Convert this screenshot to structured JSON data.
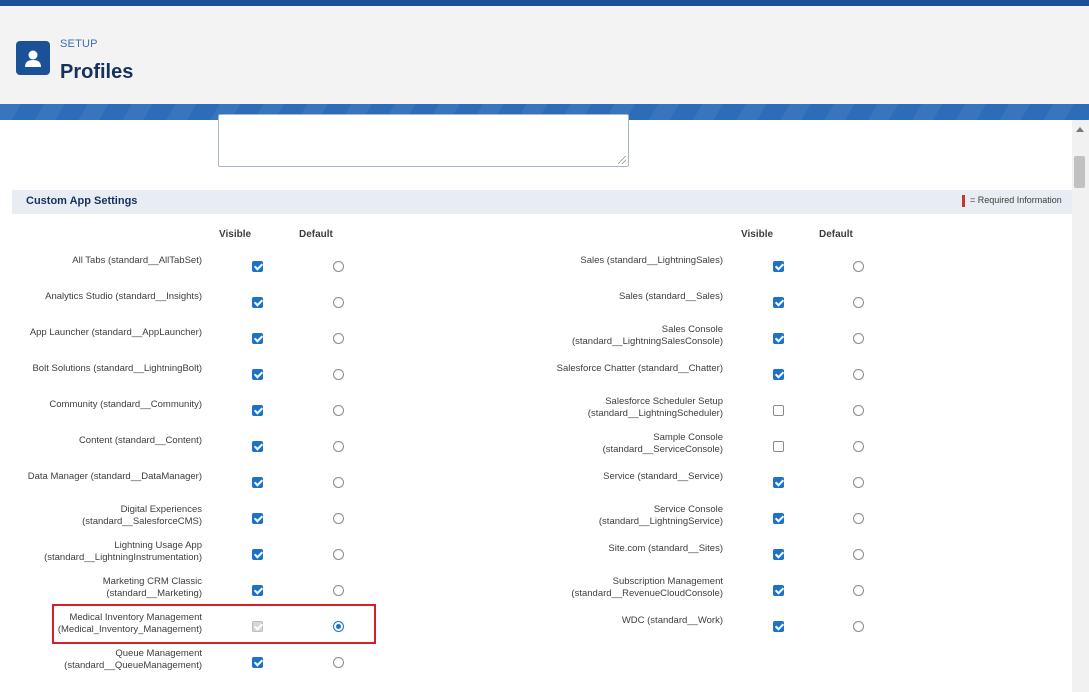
{
  "header": {
    "eyebrow": "SETUP",
    "title": "Profiles",
    "icon": "user-icon"
  },
  "section": {
    "title": "Custom App Settings",
    "required_text": "= Required Information",
    "col_visible": "Visible",
    "col_default": "Default"
  },
  "left_rows": [
    {
      "l1": "All Tabs (standard__AllTabSet)",
      "l2": "",
      "visible": "on",
      "default": false
    },
    {
      "l1": "Analytics Studio (standard__Insights)",
      "l2": "",
      "visible": "on",
      "default": false
    },
    {
      "l1": "App Launcher (standard__AppLauncher)",
      "l2": "",
      "visible": "on",
      "default": false
    },
    {
      "l1": "Bolt Solutions (standard__LightningBolt)",
      "l2": "",
      "visible": "on",
      "default": false
    },
    {
      "l1": "Community (standard__Community)",
      "l2": "",
      "visible": "on",
      "default": false
    },
    {
      "l1": "Content (standard__Content)",
      "l2": "",
      "visible": "on",
      "default": false
    },
    {
      "l1": "Data Manager (standard__DataManager)",
      "l2": "",
      "visible": "on",
      "default": false
    },
    {
      "l1": "Digital Experiences",
      "l2": "(standard__SalesforceCMS)",
      "visible": "on",
      "default": false
    },
    {
      "l1": "Lightning Usage App",
      "l2": "(standard__LightningInstrumentation)",
      "visible": "on",
      "default": false
    },
    {
      "l1": "Marketing CRM Classic",
      "l2": "(standard__Marketing)",
      "visible": "on",
      "default": false
    },
    {
      "l1": "Medical Inventory Management",
      "l2": "(Medical_Inventory_Management)",
      "visible": "disabled",
      "default": true
    },
    {
      "l1": "Queue Management",
      "l2": "(standard__QueueManagement)",
      "visible": "on",
      "default": false
    }
  ],
  "right_rows": [
    {
      "l1": "Sales (standard__LightningSales)",
      "l2": "",
      "visible": "on",
      "default": false
    },
    {
      "l1": "Sales (standard__Sales)",
      "l2": "",
      "visible": "on",
      "default": false
    },
    {
      "l1": "Sales Console",
      "l2": "(standard__LightningSalesConsole)",
      "visible": "on",
      "default": false
    },
    {
      "l1": "Salesforce Chatter (standard__Chatter)",
      "l2": "",
      "visible": "on",
      "default": false
    },
    {
      "l1": "Salesforce Scheduler Setup",
      "l2": "(standard__LightningScheduler)",
      "visible": "off",
      "default": false
    },
    {
      "l1": "Sample Console",
      "l2": "(standard__ServiceConsole)",
      "visible": "off",
      "default": false
    },
    {
      "l1": "Service (standard__Service)",
      "l2": "",
      "visible": "on",
      "default": false
    },
    {
      "l1": "Service Console",
      "l2": "(standard__LightningService)",
      "visible": "on",
      "default": false
    },
    {
      "l1": "Site.com (standard__Sites)",
      "l2": "",
      "visible": "on",
      "default": false
    },
    {
      "l1": "Subscription Management",
      "l2": "(standard__RevenueCloudConsole)",
      "visible": "on",
      "default": false
    },
    {
      "l1": "WDC (standard__Work)",
      "l2": "",
      "visible": "on",
      "default": false
    }
  ],
  "colors": {
    "brand": "#1b5297",
    "checkbox": "#1a73c9",
    "highlight": "#d0202a"
  }
}
